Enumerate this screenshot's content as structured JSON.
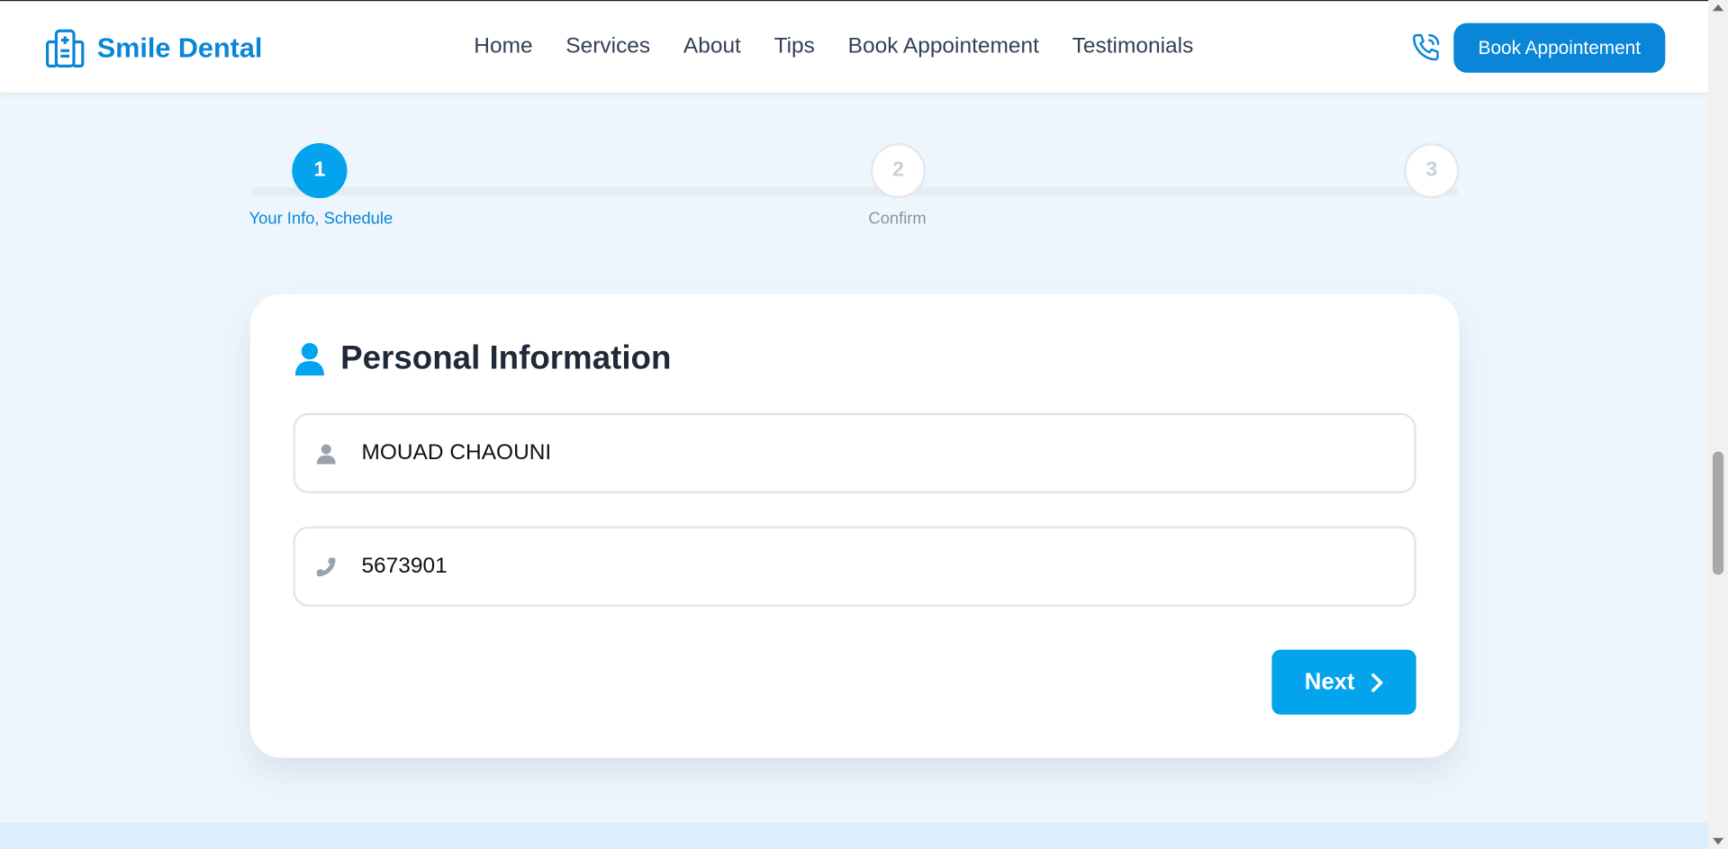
{
  "header": {
    "logo_text": "Smile Dental",
    "nav": [
      "Home",
      "Services",
      "About",
      "Tips",
      "Book Appointement",
      "Testimonials"
    ],
    "cta_label": "Book Appointement"
  },
  "stepper": {
    "steps": [
      {
        "number": "1",
        "label": "Your Info, Schedule",
        "state": "active"
      },
      {
        "number": "2",
        "label": "Confirm",
        "state": "inactive"
      },
      {
        "number": "3",
        "label": "",
        "state": "inactive"
      }
    ]
  },
  "form": {
    "title": "Personal Information",
    "name_value": "MOUAD CHAOUNI",
    "phone_value": "5673901",
    "next_label": "Next"
  },
  "colors": {
    "brand": "#0a86d8",
    "accent": "#03a4ed",
    "background": "#eef6fd"
  },
  "icons": {
    "logo": "hospital-icon",
    "phone": "phone-icon",
    "person": "user-icon",
    "next": "chevron-right-icon"
  }
}
